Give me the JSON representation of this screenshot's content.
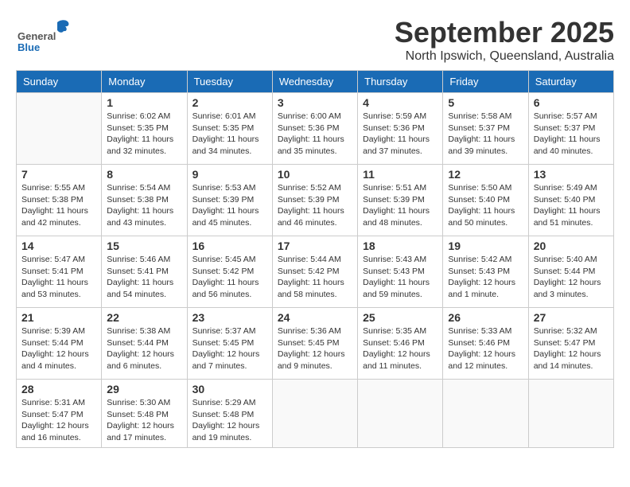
{
  "header": {
    "logo_general": "General",
    "logo_blue": "Blue",
    "month": "September 2025",
    "location": "North Ipswich, Queensland, Australia"
  },
  "days_of_week": [
    "Sunday",
    "Monday",
    "Tuesday",
    "Wednesday",
    "Thursday",
    "Friday",
    "Saturday"
  ],
  "weeks": [
    [
      {
        "day": "",
        "sunrise": "",
        "sunset": "",
        "daylight": ""
      },
      {
        "day": "1",
        "sunrise": "Sunrise: 6:02 AM",
        "sunset": "Sunset: 5:35 PM",
        "daylight": "Daylight: 11 hours and 32 minutes."
      },
      {
        "day": "2",
        "sunrise": "Sunrise: 6:01 AM",
        "sunset": "Sunset: 5:35 PM",
        "daylight": "Daylight: 11 hours and 34 minutes."
      },
      {
        "day": "3",
        "sunrise": "Sunrise: 6:00 AM",
        "sunset": "Sunset: 5:36 PM",
        "daylight": "Daylight: 11 hours and 35 minutes."
      },
      {
        "day": "4",
        "sunrise": "Sunrise: 5:59 AM",
        "sunset": "Sunset: 5:36 PM",
        "daylight": "Daylight: 11 hours and 37 minutes."
      },
      {
        "day": "5",
        "sunrise": "Sunrise: 5:58 AM",
        "sunset": "Sunset: 5:37 PM",
        "daylight": "Daylight: 11 hours and 39 minutes."
      },
      {
        "day": "6",
        "sunrise": "Sunrise: 5:57 AM",
        "sunset": "Sunset: 5:37 PM",
        "daylight": "Daylight: 11 hours and 40 minutes."
      }
    ],
    [
      {
        "day": "7",
        "sunrise": "Sunrise: 5:55 AM",
        "sunset": "Sunset: 5:38 PM",
        "daylight": "Daylight: 11 hours and 42 minutes."
      },
      {
        "day": "8",
        "sunrise": "Sunrise: 5:54 AM",
        "sunset": "Sunset: 5:38 PM",
        "daylight": "Daylight: 11 hours and 43 minutes."
      },
      {
        "day": "9",
        "sunrise": "Sunrise: 5:53 AM",
        "sunset": "Sunset: 5:39 PM",
        "daylight": "Daylight: 11 hours and 45 minutes."
      },
      {
        "day": "10",
        "sunrise": "Sunrise: 5:52 AM",
        "sunset": "Sunset: 5:39 PM",
        "daylight": "Daylight: 11 hours and 46 minutes."
      },
      {
        "day": "11",
        "sunrise": "Sunrise: 5:51 AM",
        "sunset": "Sunset: 5:39 PM",
        "daylight": "Daylight: 11 hours and 48 minutes."
      },
      {
        "day": "12",
        "sunrise": "Sunrise: 5:50 AM",
        "sunset": "Sunset: 5:40 PM",
        "daylight": "Daylight: 11 hours and 50 minutes."
      },
      {
        "day": "13",
        "sunrise": "Sunrise: 5:49 AM",
        "sunset": "Sunset: 5:40 PM",
        "daylight": "Daylight: 11 hours and 51 minutes."
      }
    ],
    [
      {
        "day": "14",
        "sunrise": "Sunrise: 5:47 AM",
        "sunset": "Sunset: 5:41 PM",
        "daylight": "Daylight: 11 hours and 53 minutes."
      },
      {
        "day": "15",
        "sunrise": "Sunrise: 5:46 AM",
        "sunset": "Sunset: 5:41 PM",
        "daylight": "Daylight: 11 hours and 54 minutes."
      },
      {
        "day": "16",
        "sunrise": "Sunrise: 5:45 AM",
        "sunset": "Sunset: 5:42 PM",
        "daylight": "Daylight: 11 hours and 56 minutes."
      },
      {
        "day": "17",
        "sunrise": "Sunrise: 5:44 AM",
        "sunset": "Sunset: 5:42 PM",
        "daylight": "Daylight: 11 hours and 58 minutes."
      },
      {
        "day": "18",
        "sunrise": "Sunrise: 5:43 AM",
        "sunset": "Sunset: 5:43 PM",
        "daylight": "Daylight: 11 hours and 59 minutes."
      },
      {
        "day": "19",
        "sunrise": "Sunrise: 5:42 AM",
        "sunset": "Sunset: 5:43 PM",
        "daylight": "Daylight: 12 hours and 1 minute."
      },
      {
        "day": "20",
        "sunrise": "Sunrise: 5:40 AM",
        "sunset": "Sunset: 5:44 PM",
        "daylight": "Daylight: 12 hours and 3 minutes."
      }
    ],
    [
      {
        "day": "21",
        "sunrise": "Sunrise: 5:39 AM",
        "sunset": "Sunset: 5:44 PM",
        "daylight": "Daylight: 12 hours and 4 minutes."
      },
      {
        "day": "22",
        "sunrise": "Sunrise: 5:38 AM",
        "sunset": "Sunset: 5:44 PM",
        "daylight": "Daylight: 12 hours and 6 minutes."
      },
      {
        "day": "23",
        "sunrise": "Sunrise: 5:37 AM",
        "sunset": "Sunset: 5:45 PM",
        "daylight": "Daylight: 12 hours and 7 minutes."
      },
      {
        "day": "24",
        "sunrise": "Sunrise: 5:36 AM",
        "sunset": "Sunset: 5:45 PM",
        "daylight": "Daylight: 12 hours and 9 minutes."
      },
      {
        "day": "25",
        "sunrise": "Sunrise: 5:35 AM",
        "sunset": "Sunset: 5:46 PM",
        "daylight": "Daylight: 12 hours and 11 minutes."
      },
      {
        "day": "26",
        "sunrise": "Sunrise: 5:33 AM",
        "sunset": "Sunset: 5:46 PM",
        "daylight": "Daylight: 12 hours and 12 minutes."
      },
      {
        "day": "27",
        "sunrise": "Sunrise: 5:32 AM",
        "sunset": "Sunset: 5:47 PM",
        "daylight": "Daylight: 12 hours and 14 minutes."
      }
    ],
    [
      {
        "day": "28",
        "sunrise": "Sunrise: 5:31 AM",
        "sunset": "Sunset: 5:47 PM",
        "daylight": "Daylight: 12 hours and 16 minutes."
      },
      {
        "day": "29",
        "sunrise": "Sunrise: 5:30 AM",
        "sunset": "Sunset: 5:48 PM",
        "daylight": "Daylight: 12 hours and 17 minutes."
      },
      {
        "day": "30",
        "sunrise": "Sunrise: 5:29 AM",
        "sunset": "Sunset: 5:48 PM",
        "daylight": "Daylight: 12 hours and 19 minutes."
      },
      {
        "day": "",
        "sunrise": "",
        "sunset": "",
        "daylight": ""
      },
      {
        "day": "",
        "sunrise": "",
        "sunset": "",
        "daylight": ""
      },
      {
        "day": "",
        "sunrise": "",
        "sunset": "",
        "daylight": ""
      },
      {
        "day": "",
        "sunrise": "",
        "sunset": "",
        "daylight": ""
      }
    ]
  ]
}
